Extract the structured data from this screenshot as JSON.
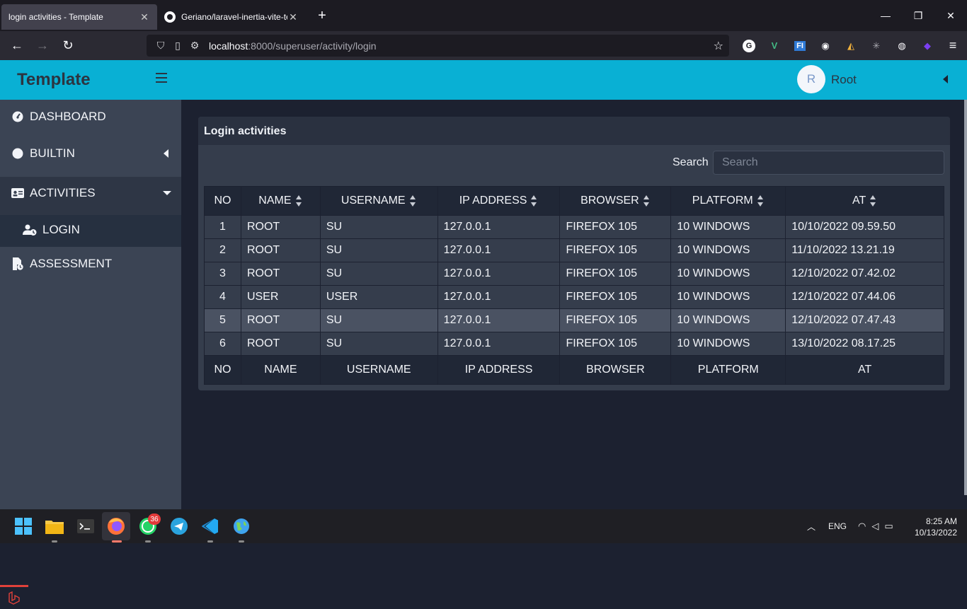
{
  "browser": {
    "tabs": [
      {
        "title": "login activities - Template",
        "active": true
      },
      {
        "title": "Geriano/laravel-inertia-vite-tem",
        "active": false
      }
    ],
    "url_host": "localhost",
    "url_path": ":8000/superuser/activity/login",
    "extensions": [
      "G",
      "V",
      "FI",
      "cookie-icon",
      "bookmark-icon",
      "bug-icon",
      "globe-icon",
      "diamond-icon"
    ]
  },
  "app": {
    "brand": "Template",
    "user": {
      "initial": "R",
      "name": "Root"
    }
  },
  "sidebar": {
    "items": [
      {
        "label": "DASHBOARD",
        "icon": "gauge-icon"
      },
      {
        "label": "BUILTIN",
        "icon": "circle-icon"
      },
      {
        "label": "ACTIVITIES",
        "icon": "id-card-icon"
      },
      {
        "label": "LOGIN",
        "icon": "user-clock-icon"
      },
      {
        "label": "ASSESSMENT",
        "icon": "file-clock-icon"
      }
    ]
  },
  "card": {
    "title": "Login activities",
    "search_label": "Search",
    "search_placeholder": "Search"
  },
  "table": {
    "columns": [
      "NO",
      "NAME",
      "USERNAME",
      "IP ADDRESS",
      "BROWSER",
      "PLATFORM",
      "AT"
    ],
    "rows": [
      [
        "1",
        "ROOT",
        "SU",
        "127.0.0.1",
        "FIREFOX 105",
        "10 WINDOWS",
        "10/10/2022 09.59.50"
      ],
      [
        "2",
        "ROOT",
        "SU",
        "127.0.0.1",
        "FIREFOX 105",
        "10 WINDOWS",
        "11/10/2022 13.21.19"
      ],
      [
        "3",
        "ROOT",
        "SU",
        "127.0.0.1",
        "FIREFOX 105",
        "10 WINDOWS",
        "12/10/2022 07.42.02"
      ],
      [
        "4",
        "USER",
        "USER",
        "127.0.0.1",
        "FIREFOX 105",
        "10 WINDOWS",
        "12/10/2022 07.44.06"
      ],
      [
        "5",
        "ROOT",
        "SU",
        "127.0.0.1",
        "FIREFOX 105",
        "10 WINDOWS",
        "12/10/2022 07.47.43"
      ],
      [
        "6",
        "ROOT",
        "SU",
        "127.0.0.1",
        "FIREFOX 105",
        "10 WINDOWS",
        "13/10/2022 08.17.25"
      ]
    ]
  },
  "taskbar": {
    "whatsapp_badge": "36",
    "language": "ENG",
    "time": "8:25 AM",
    "date": "10/13/2022"
  },
  "colors": {
    "header": "#09b0d4",
    "sidebar": "#3b4454",
    "main": "#1c2130",
    "card": "#353d4c"
  }
}
